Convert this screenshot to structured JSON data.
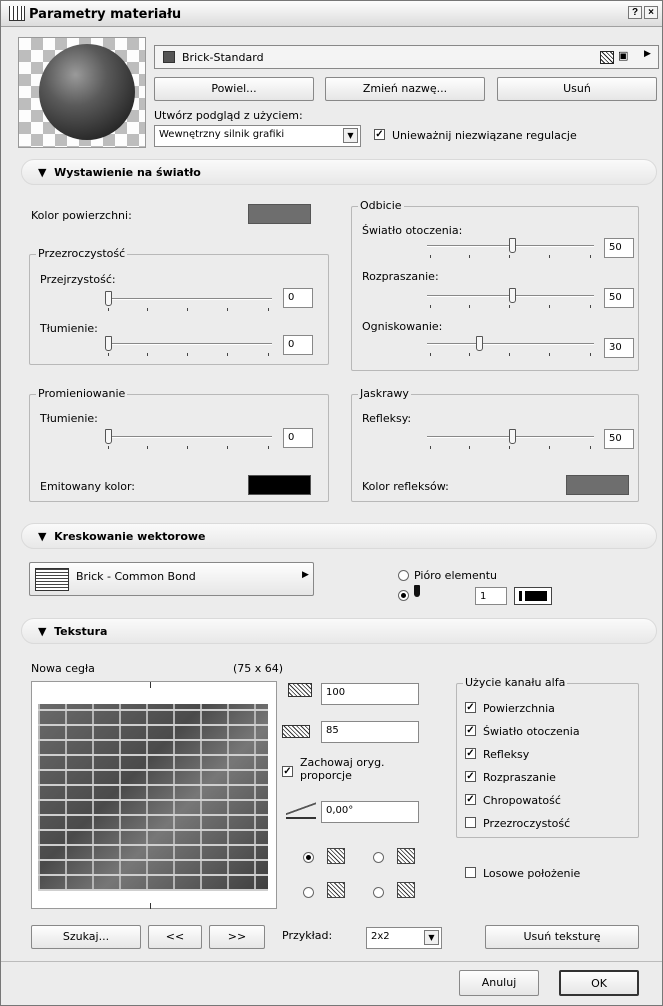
{
  "window": {
    "title": "Parametry materiału",
    "help": "?",
    "close": "×"
  },
  "material": {
    "name": "Brick-Standard",
    "color": "#555555"
  },
  "buttons": {
    "duplicate": "Powiel...",
    "rename": "Zmień nazwę...",
    "delete": "Usuń"
  },
  "preview": {
    "label": "Utwórz podgląd z użyciem:",
    "engine": "Wewnętrzny silnik grafiki",
    "invalidate_label": "Unieważnij niezwiązane regulacje",
    "invalidate_checked": true
  },
  "exposure": {
    "title": "Wystawienie na światło",
    "surface_color_label": "Kolor powierzchni:",
    "surface_color": "#6e6e6e",
    "transparency": {
      "title": "Przezroczystość",
      "transparency_label": "Przejrzystość:",
      "transparency_value": "0",
      "attenuation_label": "Tłumienie:",
      "attenuation_value": "0"
    },
    "emission": {
      "title": "Promieniowanie",
      "attenuation_label": "Tłumienie:",
      "attenuation_value": "0",
      "emitted_color_label": "Emitowany kolor:",
      "emitted_color": "#000000"
    },
    "reflection": {
      "title": "Odbicie",
      "ambient_label": "Światło otoczenia:",
      "ambient_value": "50",
      "diffuse_label": "Rozpraszanie:",
      "diffuse_value": "50",
      "specular_label": "Ogniskowanie:",
      "specular_value": "30"
    },
    "shine": {
      "title": "Jaskrawy",
      "highlight_label": "Refleksy:",
      "highlight_value": "50",
      "highlight_color_label": "Kolor refleksów:",
      "highlight_color": "#6e6e6e"
    }
  },
  "vector_hatch": {
    "title": "Kreskowanie wektorowe",
    "pattern": "Brick - Common Bond",
    "pen_option_label": "Pióro elementu",
    "pen_number": "1"
  },
  "texture": {
    "title": "Tekstura",
    "name": "Nowa cegła",
    "dimensions": "(75 x 64)",
    "width": "100",
    "height": "85",
    "keep_ratio_label": "Zachowaj oryg. proporcje",
    "keep_ratio_checked": true,
    "angle": "0,00°",
    "alpha": {
      "title": "Użycie kanału alfa",
      "items": [
        {
          "label": "Powierzchnia",
          "checked": true
        },
        {
          "label": "Światło otoczenia",
          "checked": true
        },
        {
          "label": "Refleksy",
          "checked": true
        },
        {
          "label": "Rozpraszanie",
          "checked": true
        },
        {
          "label": "Chropowatość",
          "checked": true
        },
        {
          "label": "Przezroczystość",
          "checked": false
        }
      ]
    },
    "random_label": "Losowe położenie",
    "search_button": "Szukaj...",
    "prev_button": "<<",
    "next_button": ">>",
    "example_label": "Przykład:",
    "example_value": "2x2",
    "remove_button": "Usuń teksturę"
  },
  "footer": {
    "cancel": "Anuluj",
    "ok": "OK"
  }
}
